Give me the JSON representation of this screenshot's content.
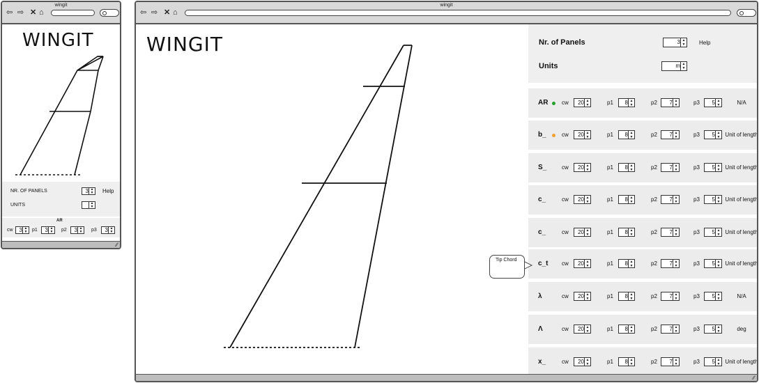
{
  "window_title": "wingit",
  "app_title": "WINGIT",
  "nav_icons": [
    "back-arrow-icon",
    "forward-arrow-icon",
    "close-x-icon",
    "home-icon"
  ],
  "mobile": {
    "panels_label": "NR. OF PANELS",
    "panels_value": "3",
    "help_label": "Help",
    "units_label": "UNITS",
    "units_value": "",
    "row_name": "AR",
    "cw_label": "cw",
    "cw_value": "3",
    "p1_label": "p1",
    "p1_value": "3",
    "p2_label": "p2",
    "p2_value": "3",
    "p3_label": "p3",
    "p3_value": "3"
  },
  "desktop": {
    "panels_label": "Nr. of Panels",
    "panels_value": "3",
    "help_label": "Help",
    "units_label": "Units",
    "units_value": "m",
    "tooltip": "Tip Chord",
    "headers": {
      "cw": "cw",
      "p1": "p1",
      "p2": "p2",
      "p3": "p3"
    },
    "rows": [
      {
        "name": "AR",
        "dot": "#22a02a",
        "cw": "20",
        "p1": "8",
        "p2": "7",
        "p3": "5",
        "unit": "N/A"
      },
      {
        "name": "b_",
        "dot": "#f0a030",
        "cw": "20",
        "p1": "8",
        "p2": "7",
        "p3": "5",
        "unit": "Unit of length"
      },
      {
        "name": "S_",
        "cw": "20",
        "p1": "8",
        "p2": "7",
        "p3": "5",
        "unit": "Unit of length"
      },
      {
        "name": "c_",
        "cw": "20",
        "p1": "8",
        "p2": "7",
        "p3": "5",
        "unit": "Unit of length"
      },
      {
        "name": "c_",
        "cw": "20",
        "p1": "8",
        "p2": "7",
        "p3": "5",
        "unit": "Unit of length"
      },
      {
        "name": "c_t",
        "cw": "20",
        "p1": "8",
        "p2": "7",
        "p3": "5",
        "unit": "Unit of length"
      },
      {
        "name": "λ",
        "cw": "20",
        "p1": "8",
        "p2": "7",
        "p3": "5",
        "unit": "N/A"
      },
      {
        "name": "Λ",
        "cw": "20",
        "p1": "8",
        "p2": "7",
        "p3": "5",
        "unit": "deg"
      },
      {
        "name": "x_",
        "cw": "20",
        "p1": "8",
        "p2": "7",
        "p3": "5",
        "unit": "Unit of length"
      }
    ]
  }
}
